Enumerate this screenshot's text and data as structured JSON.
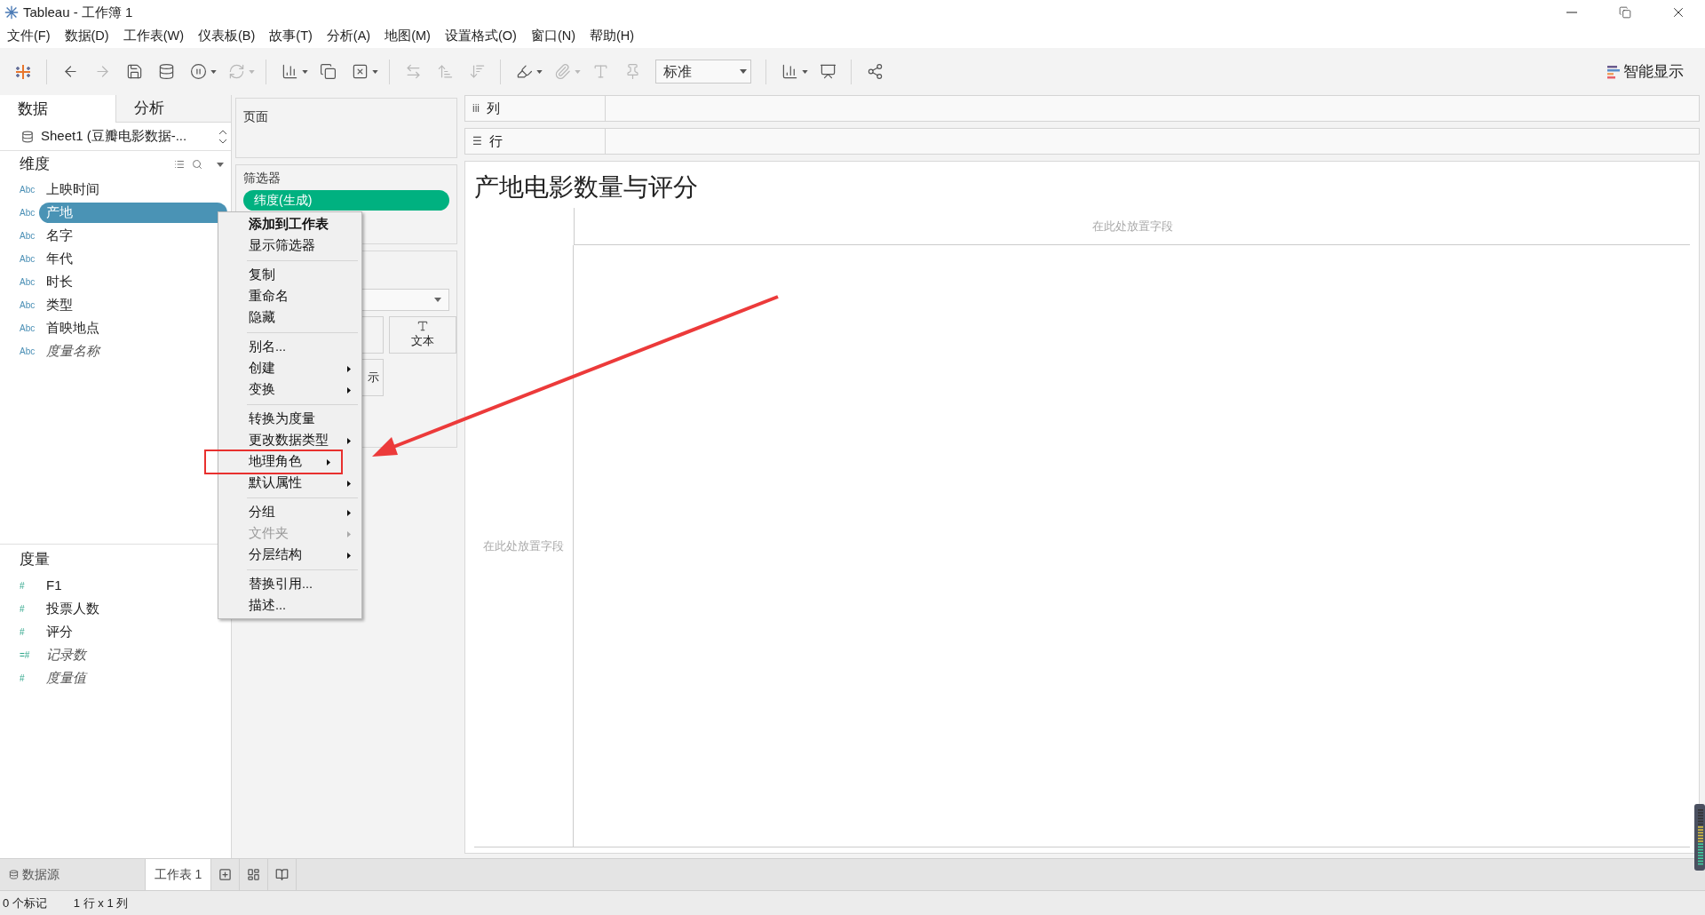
{
  "window": {
    "title": "Tableau - 工作簿 1"
  },
  "menubar": [
    "文件(F)",
    "数据(D)",
    "工作表(W)",
    "仪表板(B)",
    "故事(T)",
    "分析(A)",
    "地图(M)",
    "设置格式(O)",
    "窗口(N)",
    "帮助(H)"
  ],
  "toolbar": [
    {
      "kind": "logo"
    },
    {
      "kind": "separator"
    },
    {
      "kind": "undo",
      "disabled": false,
      "dropdown": false
    },
    {
      "kind": "redo",
      "disabled": true,
      "dropdown": false
    },
    {
      "kind": "save",
      "disabled": false,
      "dropdown": false
    },
    {
      "kind": "add-data",
      "disabled": false,
      "dropdown": false
    },
    {
      "kind": "pause",
      "disabled": false,
      "dropdown": true
    },
    {
      "kind": "refresh",
      "disabled": true,
      "dropdown": true
    },
    {
      "kind": "separator"
    },
    {
      "kind": "new-sheet",
      "disabled": false,
      "dropdown": true
    },
    {
      "kind": "duplicate",
      "disabled": false,
      "dropdown": false
    },
    {
      "kind": "clear",
      "disabled": false,
      "dropdown": true
    },
    {
      "kind": "separator"
    },
    {
      "kind": "swap",
      "disabled": true,
      "dropdown": false
    },
    {
      "kind": "sort-asc",
      "disabled": true,
      "dropdown": false
    },
    {
      "kind": "sort-desc",
      "disabled": true,
      "dropdown": false
    },
    {
      "kind": "separator"
    },
    {
      "kind": "highlight",
      "disabled": false,
      "dropdown": true
    },
    {
      "kind": "group",
      "disabled": true,
      "dropdown": true
    },
    {
      "kind": "label",
      "disabled": true,
      "dropdown": false
    },
    {
      "kind": "pin",
      "disabled": true,
      "dropdown": false
    },
    {
      "kind": "select",
      "label": "标准"
    },
    {
      "kind": "separator"
    },
    {
      "kind": "show-me",
      "disabled": false,
      "dropdown": true
    },
    {
      "kind": "presentation",
      "disabled": false,
      "dropdown": false
    },
    {
      "kind": "separator"
    },
    {
      "kind": "share",
      "disabled": false,
      "dropdown": false
    }
  ],
  "show_me": {
    "label": "智能显示"
  },
  "side_tabs": [
    {
      "label": "数据",
      "selected": true
    },
    {
      "label": "分析",
      "selected": false
    }
  ],
  "data_source": {
    "label": "Sheet1 (豆瓣电影数据-..."
  },
  "dimensions": {
    "title": "维度",
    "fields": [
      {
        "icon": "Abc",
        "label": "上映时间",
        "italic": false,
        "selected": false
      },
      {
        "icon": "Abc",
        "label": "产地",
        "italic": false,
        "selected": true
      },
      {
        "icon": "Abc",
        "label": "名字",
        "italic": false,
        "selected": false
      },
      {
        "icon": "Abc",
        "label": "年代",
        "italic": false,
        "selected": false
      },
      {
        "icon": "Abc",
        "label": "时长",
        "italic": false,
        "selected": false
      },
      {
        "icon": "Abc",
        "label": "类型",
        "italic": false,
        "selected": false
      },
      {
        "icon": "Abc",
        "label": "首映地点",
        "italic": false,
        "selected": false
      },
      {
        "icon": "Abc",
        "label": "度量名称",
        "italic": true,
        "selected": false
      }
    ]
  },
  "measures": {
    "title": "度量",
    "fields": [
      {
        "icon": "#",
        "label": "F1",
        "italic": false,
        "selected": false
      },
      {
        "icon": "#",
        "label": "投票人数",
        "italic": false,
        "selected": false
      },
      {
        "icon": "#",
        "label": "评分",
        "italic": false,
        "selected": false
      },
      {
        "icon": "=#",
        "label": "记录数",
        "italic": true,
        "selected": false
      },
      {
        "icon": "#",
        "label": "度量值",
        "italic": true,
        "selected": false
      }
    ]
  },
  "pages_card": {
    "title": "页面"
  },
  "filters_card": {
    "title": "筛选器",
    "pills": [
      "纬度(生成)"
    ]
  },
  "marks_card": {
    "buttons": [
      {
        "kind": "blank"
      },
      {
        "kind": "text",
        "label": "文本"
      },
      {
        "kind": "partial",
        "label": "示"
      }
    ]
  },
  "shelves": [
    {
      "icon": "iii",
      "label": "列"
    },
    {
      "icon": "☰",
      "label": "行"
    }
  ],
  "view": {
    "title": "产地电影数量与评分",
    "drop_top": "在此处放置字段",
    "drop_left": "在此处放置字段"
  },
  "context_menu": [
    {
      "kind": "item",
      "label": "添加到工作表",
      "bold": true,
      "submenu": false,
      "disabled": false,
      "boxed": false
    },
    {
      "kind": "item",
      "label": "显示筛选器",
      "bold": false,
      "submenu": false,
      "disabled": false,
      "boxed": false
    },
    {
      "kind": "separator"
    },
    {
      "kind": "item",
      "label": "复制",
      "bold": false,
      "submenu": false,
      "disabled": false,
      "boxed": false
    },
    {
      "kind": "item",
      "label": "重命名",
      "bold": false,
      "submenu": false,
      "disabled": false,
      "boxed": false
    },
    {
      "kind": "item",
      "label": "隐藏",
      "bold": false,
      "submenu": false,
      "disabled": false,
      "boxed": false
    },
    {
      "kind": "separator"
    },
    {
      "kind": "item",
      "label": "别名...",
      "bold": false,
      "submenu": false,
      "disabled": false,
      "boxed": false
    },
    {
      "kind": "item",
      "label": "创建",
      "bold": false,
      "submenu": true,
      "disabled": false,
      "boxed": false
    },
    {
      "kind": "item",
      "label": "变换",
      "bold": false,
      "submenu": true,
      "disabled": false,
      "boxed": false
    },
    {
      "kind": "separator"
    },
    {
      "kind": "item",
      "label": "转换为度量",
      "bold": false,
      "submenu": false,
      "disabled": false,
      "boxed": false
    },
    {
      "kind": "item",
      "label": "更改数据类型",
      "bold": false,
      "submenu": true,
      "disabled": false,
      "boxed": false
    },
    {
      "kind": "item",
      "label": "地理角色",
      "bold": false,
      "submenu": true,
      "disabled": false,
      "boxed": true
    },
    {
      "kind": "item",
      "label": "默认属性",
      "bold": false,
      "submenu": true,
      "disabled": false,
      "boxed": false
    },
    {
      "kind": "separator"
    },
    {
      "kind": "item",
      "label": "分组",
      "bold": false,
      "submenu": true,
      "disabled": false,
      "boxed": false
    },
    {
      "kind": "item",
      "label": "文件夹",
      "bold": false,
      "submenu": true,
      "disabled": true,
      "boxed": false
    },
    {
      "kind": "item",
      "label": "分层结构",
      "bold": false,
      "submenu": true,
      "disabled": false,
      "boxed": false
    },
    {
      "kind": "separator"
    },
    {
      "kind": "item",
      "label": "替换引用...",
      "bold": false,
      "submenu": false,
      "disabled": false,
      "boxed": false
    },
    {
      "kind": "item",
      "label": "描述...",
      "bold": false,
      "submenu": false,
      "disabled": false,
      "boxed": false
    }
  ],
  "sheet_tabs": [
    {
      "kind": "datasource",
      "label": "数据源",
      "selected": false
    },
    {
      "kind": "sheet",
      "label": "工作表 1",
      "selected": true
    },
    {
      "kind": "new-sheet"
    },
    {
      "kind": "new-dashboard"
    },
    {
      "kind": "new-story"
    }
  ],
  "status_bar": [
    "0 个标记",
    "1 行 x 1 列"
  ]
}
